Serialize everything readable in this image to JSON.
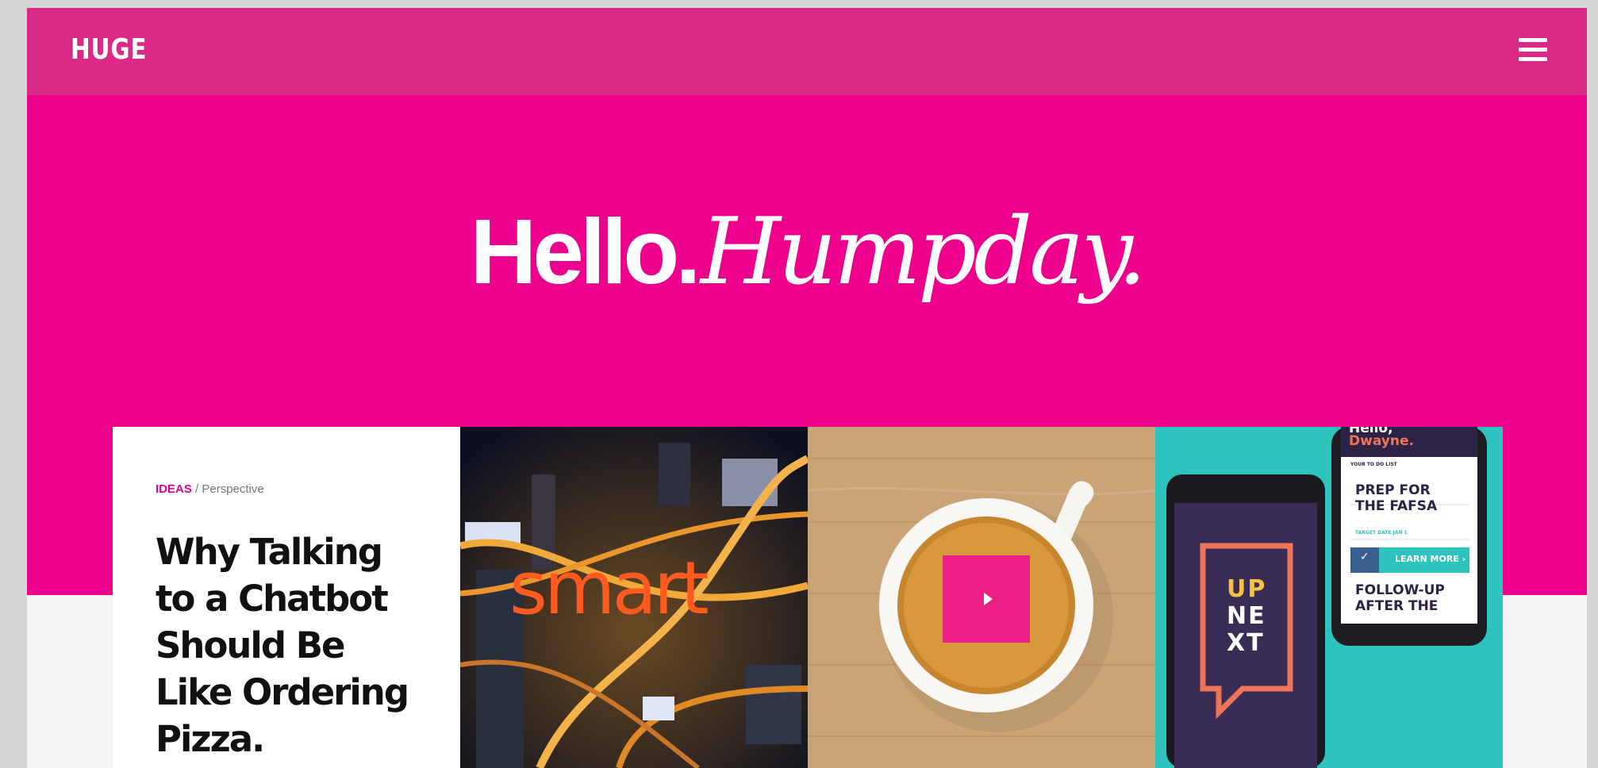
{
  "header": {
    "logo": "HUGE",
    "menu_icon": "hamburger-menu-icon"
  },
  "hero": {
    "greeting": "Hello.",
    "day": "Humpday."
  },
  "cards": [
    {
      "category": "IDEAS",
      "subcategory": "Perspective",
      "title_lines": [
        "Why Talking",
        "to a Chatbot",
        "Should Be",
        "Like Ordering",
        "Pizza."
      ]
    },
    {
      "overlay_word": "smart"
    },
    {
      "play_icon": "play-icon"
    },
    {
      "greeting": "Dwayne.",
      "partial_greeting": "Hello,",
      "list_label": "YOUR TO DO LIST",
      "task_1": "PREP FOR",
      "task_1b": "THE FAFSA",
      "task_1_date": "TARGET DATE JAN 1",
      "cta": "LEARN MORE",
      "task_2": "FOLLOW-UP",
      "task_2b": "AFTER THE",
      "up_next": [
        "UP",
        "NE",
        "XT"
      ]
    }
  ],
  "colors": {
    "brand_pink": "#ec008c",
    "topbar_pink": "#db2a85",
    "accent_orange": "#ff5a1f",
    "teal": "#2ec4bd"
  }
}
